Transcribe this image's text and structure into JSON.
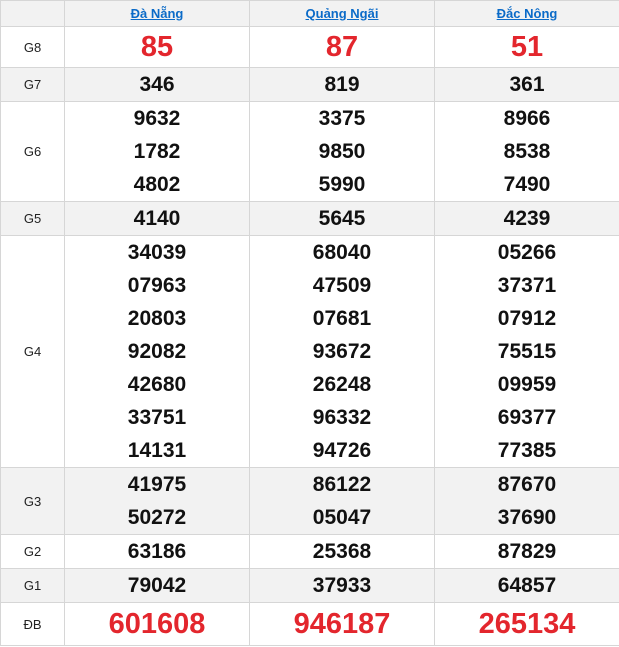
{
  "colors": {
    "accent_link": "#0b6bc8",
    "special_red": "#e3262d",
    "alt_row": "#f2f2f2"
  },
  "provinces": [
    "Đà Nẵng",
    "Quảng Ngãi",
    "Đắc Nông"
  ],
  "prizes": {
    "g8": {
      "label": "G8",
      "values": [
        [
          "85"
        ],
        [
          "87"
        ],
        [
          "51"
        ]
      ]
    },
    "g7": {
      "label": "G7",
      "values": [
        [
          "346"
        ],
        [
          "819"
        ],
        [
          "361"
        ]
      ]
    },
    "g6": {
      "label": "G6",
      "values": [
        [
          "9632",
          "1782",
          "4802"
        ],
        [
          "3375",
          "9850",
          "5990"
        ],
        [
          "8966",
          "8538",
          "7490"
        ]
      ]
    },
    "g5": {
      "label": "G5",
      "values": [
        [
          "4140"
        ],
        [
          "5645"
        ],
        [
          "4239"
        ]
      ]
    },
    "g4": {
      "label": "G4",
      "values": [
        [
          "34039",
          "07963",
          "20803",
          "92082",
          "42680",
          "33751",
          "14131"
        ],
        [
          "68040",
          "47509",
          "07681",
          "93672",
          "26248",
          "96332",
          "94726"
        ],
        [
          "05266",
          "37371",
          "07912",
          "75515",
          "09959",
          "69377",
          "77385"
        ]
      ]
    },
    "g3": {
      "label": "G3",
      "values": [
        [
          "41975",
          "50272"
        ],
        [
          "86122",
          "05047"
        ],
        [
          "87670",
          "37690"
        ]
      ]
    },
    "g2": {
      "label": "G2",
      "values": [
        [
          "63186"
        ],
        [
          "25368"
        ],
        [
          "87829"
        ]
      ]
    },
    "g1": {
      "label": "G1",
      "values": [
        [
          "79042"
        ],
        [
          "37933"
        ],
        [
          "64857"
        ]
      ]
    },
    "db": {
      "label": "ĐB",
      "values": [
        [
          "601608"
        ],
        [
          "946187"
        ],
        [
          "265134"
        ]
      ]
    }
  }
}
